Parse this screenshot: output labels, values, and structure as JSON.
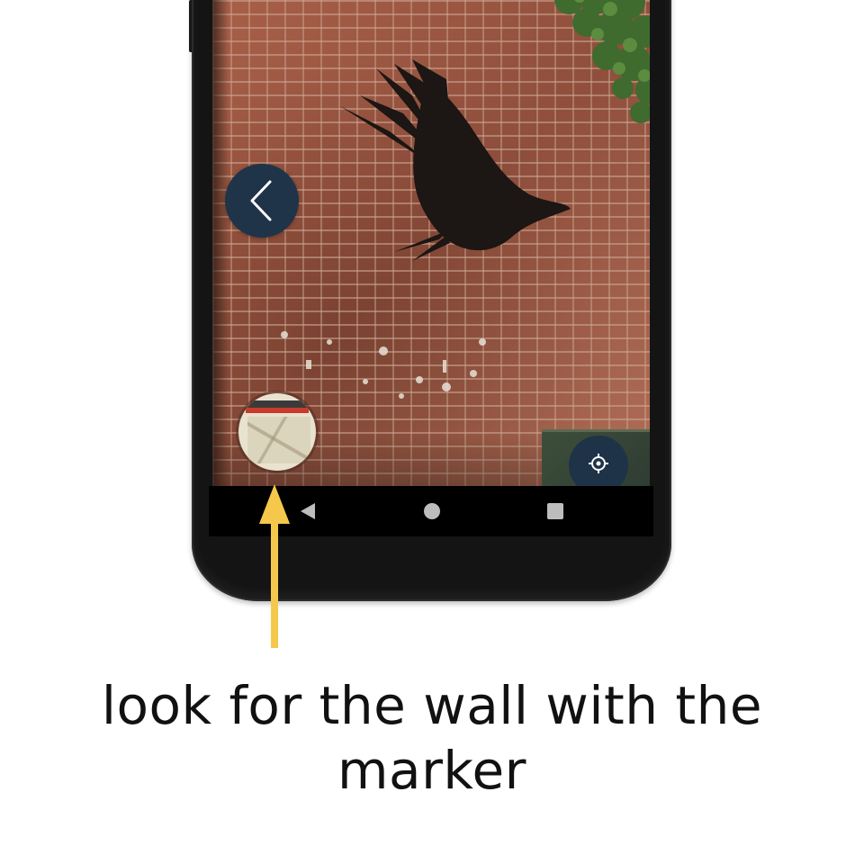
{
  "annotation": {
    "caption": "look for the wall with the marker",
    "arrow_color": "#f5c84c",
    "text_color": "#111111"
  },
  "phone": {
    "body_color": "#141414",
    "screen": {
      "back_button_icon": "chevron-left-icon",
      "marker_thumbnail_icon": "marker-map-thumbnail",
      "locate_button_icon": "crosshair-locate-icon",
      "accent_color": "#1f3448"
    },
    "nav_bar": {
      "buttons": [
        {
          "icon": "back-triangle-icon"
        },
        {
          "icon": "home-circle-icon"
        },
        {
          "icon": "recents-square-icon"
        }
      ]
    }
  }
}
